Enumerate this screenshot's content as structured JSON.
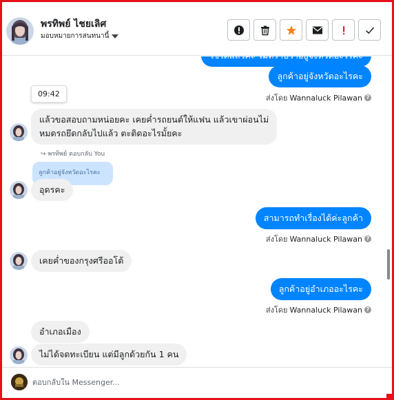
{
  "header": {
    "contact_name": "พรทิพย์ ไชยเลิศ",
    "assign_label": "มอบหมายการสนทนานี้",
    "actions": [
      {
        "icon": "alert-circle-icon"
      },
      {
        "icon": "trash-icon"
      },
      {
        "icon": "star-icon"
      },
      {
        "icon": "envelope-icon"
      },
      {
        "icon": "exclamation-icon"
      },
      {
        "icon": "checkmark-icon"
      }
    ]
  },
  "messages": {
    "out_partial": "ใช้ได้แล้วค่ะ ไม่ทราบว่าอยู่จังหวัดอะไรคะ",
    "out_1": "ลูกค้าอยู่จังหวัดอะไรคะ",
    "sent_by_1": "ส่งโดย",
    "sender_name": "Wannaluck Pilawan",
    "time_chip": "09:42",
    "in_1_line1": "แล้วขอสอบถามหน่อยคะ เคยค่ำรถยนต์ให้แฟน แล้วเขาผ่อนไม่",
    "in_1_line2": "หมดรถยึดกลับไปแล้ว ตะติดอะไรมั้ยคะ",
    "reply_label": "พรทิพย์ ตอบกลับ You",
    "quoted": "ลูกค้าอยู่จังหวัดอะไรคะ",
    "in_2": "อุดรคะ",
    "out_2": "สามารถทำเรื่องได้ค่ะลูกค้า",
    "sent_by_2": "ส่งโดย",
    "in_3": "เคยค่ำของกรุงศรีออโต้",
    "out_3": "ลูกค้าอยู่อำเภออะไรคะ",
    "sent_by_3": "ส่งโดย",
    "in_4": "อำเภอเมือง",
    "in_5": "ไม่ได้จดทะเบียน แต่มีลูกด้วยกัน 1 คน"
  },
  "composer": {
    "placeholder": "ตอบกลับใน Messenger..."
  },
  "colors": {
    "accent_blue": "#0084ff",
    "incoming_bubble": "#f0f0f0",
    "frame_red": "#e8101a",
    "star_orange": "#f5821f",
    "exclamation_red": "#e4243c"
  }
}
